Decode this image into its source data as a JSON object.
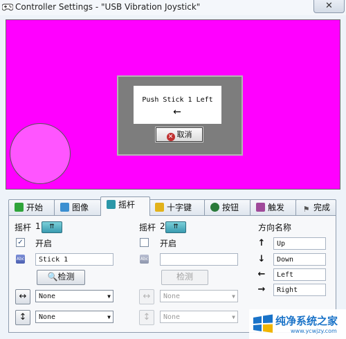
{
  "window": {
    "title": "Controller Settings - \"USB Vibration Joystick\"",
    "close_glyph": "✕"
  },
  "preview": {
    "dialog": {
      "message": "Push Stick 1 Left",
      "arrow": "←",
      "cancel_label": "取消"
    }
  },
  "tabs": [
    {
      "label": "开始",
      "icon": "arrow-right-icon",
      "color": "#2fa43a"
    },
    {
      "label": "图像",
      "icon": "picture-icon",
      "color": "#3b8fd1"
    },
    {
      "label": "摇杆",
      "icon": "joystick-icon",
      "color": "#2b97a8"
    },
    {
      "label": "十字键",
      "icon": "dpad-icon",
      "color": "#e2b21a"
    },
    {
      "label": "按钮",
      "icon": "button-icon",
      "color": "#2a7a3a"
    },
    {
      "label": "触发",
      "icon": "trigger-icon",
      "color": "#a04a9a"
    },
    {
      "label": "完成",
      "icon": "flag-icon",
      "color": "#555555"
    }
  ],
  "stick1": {
    "title": "摇杆",
    "number": "1",
    "enable_label": "开启",
    "enabled": true,
    "name_value": "Stick 1",
    "detect_label": "检测",
    "horizontal_axis": "None",
    "vertical_axis": "None"
  },
  "stick2": {
    "title": "摇杆",
    "number": "2",
    "enable_label": "开启",
    "enabled": false,
    "name_value": "",
    "detect_label": "检测",
    "horizontal_axis": "None",
    "vertical_axis": "None"
  },
  "direction_names": {
    "title": "方向名称",
    "up": "Up",
    "down": "Down",
    "left": "Left",
    "right": "Right"
  },
  "watermark": {
    "text": "纯净系统之家",
    "url": "www.ycwjzy.com"
  },
  "colors": {
    "preview_background": "#ff00ff",
    "accent": "#2b97a8"
  }
}
